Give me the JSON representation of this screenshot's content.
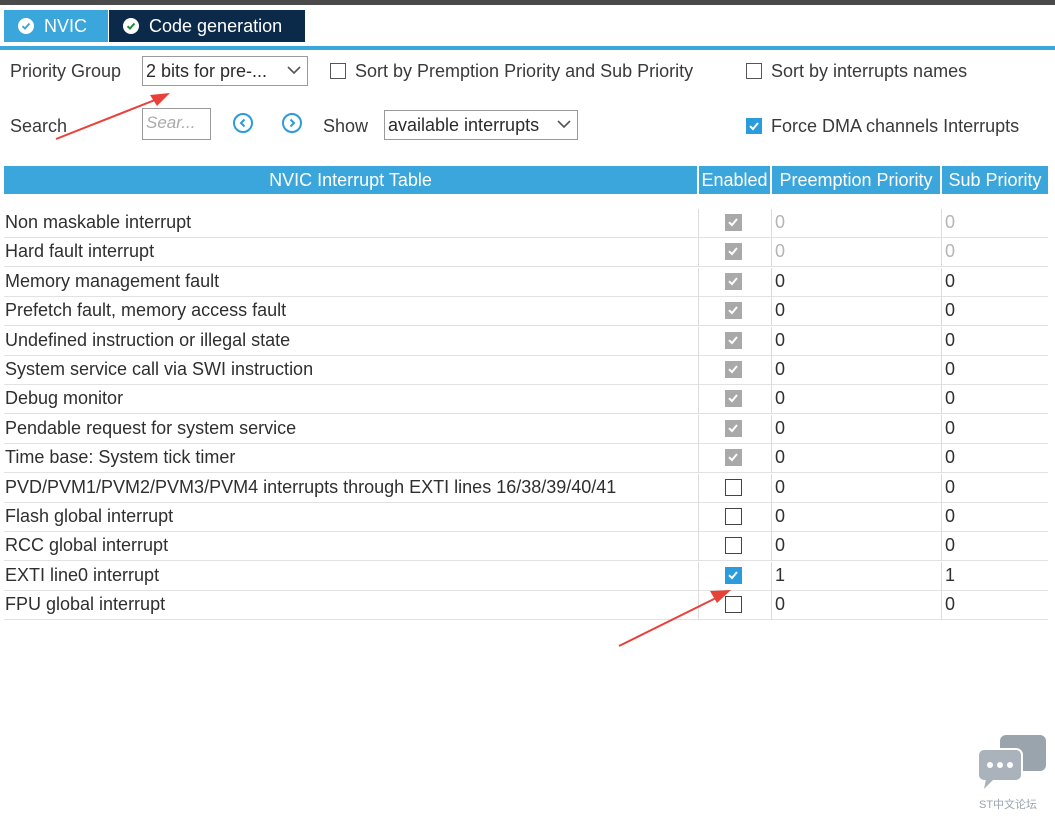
{
  "tabs": [
    {
      "label": "NVIC",
      "icon": "check-circle-icon"
    },
    {
      "label": "Code generation",
      "icon": "check-circle-icon"
    }
  ],
  "toolbar": {
    "priority_group_label": "Priority Group",
    "priority_group_value": "2 bits for pre-...",
    "sort_premption_label": "Sort by Premption Priority and Sub Priority",
    "sort_premption_checked": false,
    "sort_names_label": "Sort by interrupts names",
    "sort_names_checked": false,
    "search_label": "Search",
    "search_placeholder": "Sear...",
    "show_label": "Show",
    "show_value": "available interrupts",
    "force_dma_label": "Force DMA channels Interrupts",
    "force_dma_checked": true
  },
  "table": {
    "headers": {
      "name": "NVIC Interrupt Table",
      "enabled": "Enabled",
      "preemption": "Preemption Priority",
      "sub": "Sub Priority"
    },
    "rows": [
      {
        "name": "Non maskable interrupt",
        "enabled": "disabled-checked",
        "preemption": "0",
        "sub": "0",
        "locked": true
      },
      {
        "name": "Hard fault interrupt",
        "enabled": "disabled-checked",
        "preemption": "0",
        "sub": "0",
        "locked": true
      },
      {
        "name": "Memory management fault",
        "enabled": "disabled-checked",
        "preemption": "0",
        "sub": "0",
        "locked": false
      },
      {
        "name": "Prefetch fault, memory access fault",
        "enabled": "disabled-checked",
        "preemption": "0",
        "sub": "0",
        "locked": false
      },
      {
        "name": "Undefined instruction or illegal state",
        "enabled": "disabled-checked",
        "preemption": "0",
        "sub": "0",
        "locked": false
      },
      {
        "name": "System service call via SWI instruction",
        "enabled": "disabled-checked",
        "preemption": "0",
        "sub": "0",
        "locked": false
      },
      {
        "name": "Debug monitor",
        "enabled": "disabled-checked",
        "preemption": "0",
        "sub": "0",
        "locked": false
      },
      {
        "name": "Pendable request for system service",
        "enabled": "disabled-checked",
        "preemption": "0",
        "sub": "0",
        "locked": false
      },
      {
        "name": "Time base: System tick timer",
        "enabled": "disabled-checked",
        "preemption": "0",
        "sub": "0",
        "locked": false
      },
      {
        "name": "PVD/PVM1/PVM2/PVM3/PVM4 interrupts through EXTI lines 16/38/39/40/41",
        "enabled": "unchecked",
        "preemption": "0",
        "sub": "0",
        "locked": false
      },
      {
        "name": "Flash global interrupt",
        "enabled": "unchecked",
        "preemption": "0",
        "sub": "0",
        "locked": false
      },
      {
        "name": "RCC global interrupt",
        "enabled": "unchecked",
        "preemption": "0",
        "sub": "0",
        "locked": false
      },
      {
        "name": "EXTI line0 interrupt",
        "enabled": "checked",
        "preemption": "1",
        "sub": "1",
        "locked": false
      },
      {
        "name": "FPU global interrupt",
        "enabled": "unchecked",
        "preemption": "0",
        "sub": "0",
        "locked": false
      }
    ]
  },
  "colors": {
    "accent": "#3aa6dc",
    "tab_dark": "#0b2a4a",
    "arrow": "#e8413a"
  },
  "watermark": {
    "text": "ST中文论坛",
    "icon": "chat-bubbles-icon"
  }
}
